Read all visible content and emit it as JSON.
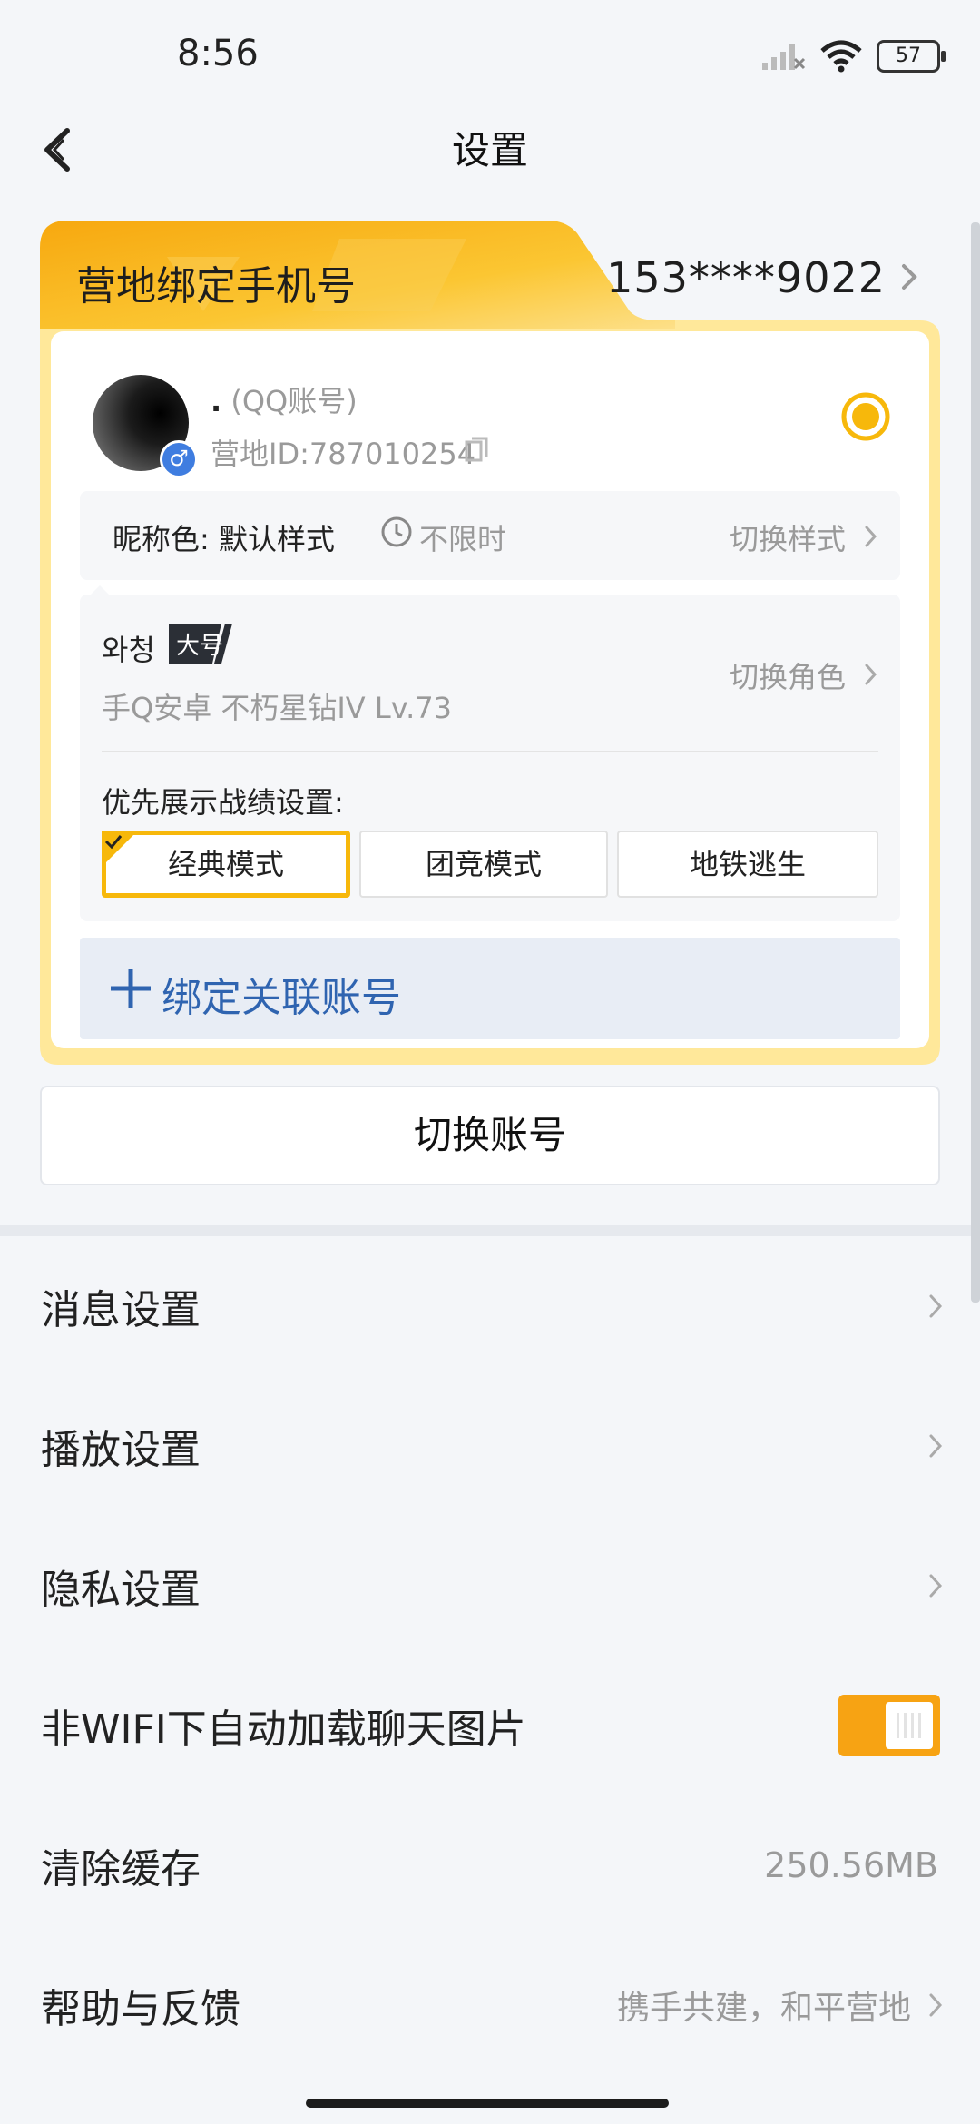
{
  "status_bar": {
    "time": "8:56",
    "battery": "57"
  },
  "header": {
    "title": "设置"
  },
  "card": {
    "phone_label": "营地绑定手机号",
    "phone_value": "153****9022",
    "nickname_dot": ".",
    "nickname_type": "(QQ账号)",
    "camp_id": "营地ID:787010254",
    "nickname_color_label": "昵称色: 默认样式",
    "unlimited": "不限时",
    "switch_style": "切换样式",
    "role_name": "와청",
    "role_badge": "大号",
    "role_sub": "手Q安卓  不朽星钻IV  Lv.73",
    "switch_role": "切换角色",
    "pref_label": "优先展示战绩设置:",
    "modes": [
      "经典模式",
      "团竞模式",
      "地铁逃生"
    ],
    "bind_label": "绑定关联账号"
  },
  "switch_account": "切换账号",
  "menu": [
    {
      "label": "消息设置"
    },
    {
      "label": "播放设置"
    },
    {
      "label": "隐私设置"
    },
    {
      "label": "非WIFI下自动加载聊天图片",
      "toggle_on": true
    },
    {
      "label": "清除缓存",
      "value": "250.56MB"
    },
    {
      "label": "帮助与反馈",
      "value": "携手共建，和平营地"
    }
  ],
  "colors": {
    "accent": "#f7b80b",
    "link": "#2f64b0",
    "toggle": "#f7a313"
  }
}
